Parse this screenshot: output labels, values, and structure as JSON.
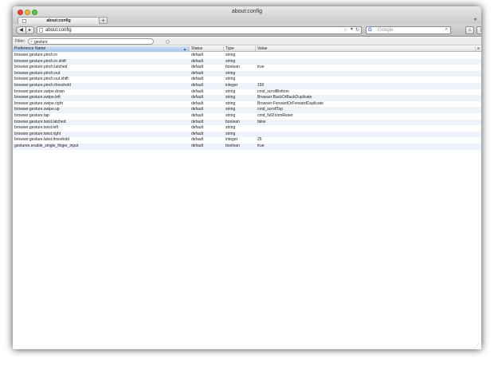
{
  "window": {
    "title": "about:config"
  },
  "tabs": [
    {
      "label": "about:config"
    }
  ],
  "navbar": {
    "url": "about:config",
    "search_engine": "G",
    "search_placeholder": "Google"
  },
  "filter": {
    "label": "Filter:",
    "value": "gesture"
  },
  "columns": {
    "name": "Preference Name",
    "status": "Status",
    "type": "Type",
    "value": "Value"
  },
  "rows": [
    {
      "name": "browser.gesture.pinch.in",
      "status": "default",
      "type": "string",
      "value": ""
    },
    {
      "name": "browser.gesture.pinch.in.shift",
      "status": "default",
      "type": "string",
      "value": ""
    },
    {
      "name": "browser.gesture.pinch.latched",
      "status": "default",
      "type": "boolean",
      "value": "true"
    },
    {
      "name": "browser.gesture.pinch.out",
      "status": "default",
      "type": "string",
      "value": ""
    },
    {
      "name": "browser.gesture.pinch.out.shift",
      "status": "default",
      "type": "string",
      "value": ""
    },
    {
      "name": "browser.gesture.pinch.threshold",
      "status": "default",
      "type": "integer",
      "value": "150"
    },
    {
      "name": "browser.gesture.swipe.down",
      "status": "default",
      "type": "string",
      "value": "cmd_scrollBottom"
    },
    {
      "name": "browser.gesture.swipe.left",
      "status": "default",
      "type": "string",
      "value": "Browser:BackOrBackDuplicate"
    },
    {
      "name": "browser.gesture.swipe.right",
      "status": "default",
      "type": "string",
      "value": "Browser:ForwardOrForwardDuplicate"
    },
    {
      "name": "browser.gesture.swipe.up",
      "status": "default",
      "type": "string",
      "value": "cmd_scrollTop"
    },
    {
      "name": "browser.gesture.tap",
      "status": "default",
      "type": "string",
      "value": "cmd_fullZoomReset"
    },
    {
      "name": "browser.gesture.twist.latched",
      "status": "default",
      "type": "boolean",
      "value": "false"
    },
    {
      "name": "browser.gesture.twist.left",
      "status": "default",
      "type": "string",
      "value": ""
    },
    {
      "name": "browser.gesture.twist.right",
      "status": "default",
      "type": "string",
      "value": ""
    },
    {
      "name": "browser.gesture.twist.threshold",
      "status": "default",
      "type": "integer",
      "value": "25"
    },
    {
      "name": "gestures.enable_single_finger_input",
      "status": "default",
      "type": "boolean",
      "value": "true"
    }
  ]
}
